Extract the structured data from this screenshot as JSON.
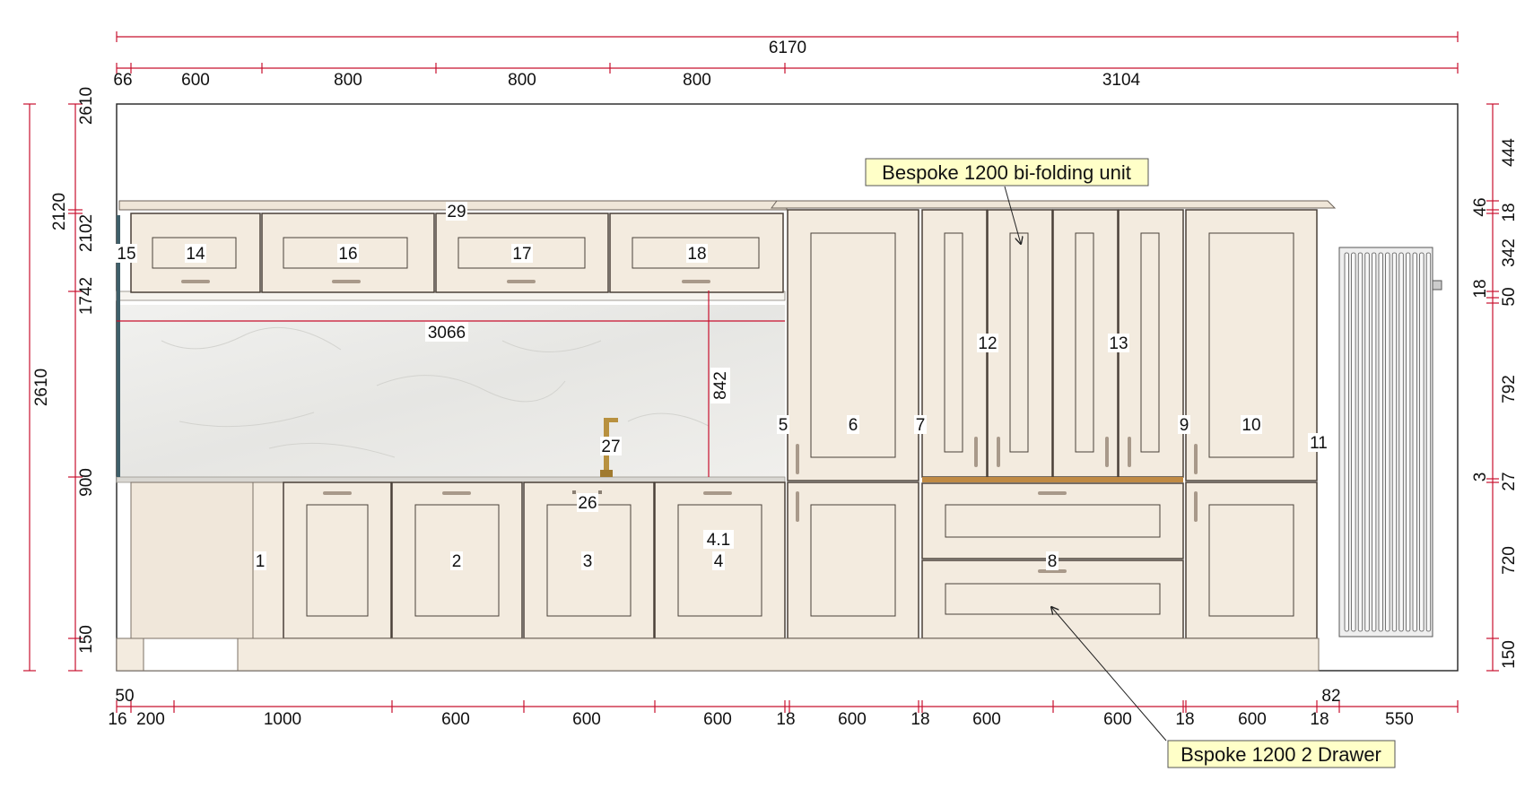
{
  "colors": {
    "dimension_line": "#c8102e",
    "cabinet_fill": "#f3ebdf",
    "cabinet_edge": "#4a4038",
    "splashback": "#ecebe8",
    "callout_fill": "#ffffc8",
    "worktop_wood": "#c08a44",
    "brass": "#b8913f"
  },
  "dimensions": {
    "overall_width": "6170",
    "top_row": [
      "66",
      "600",
      "800",
      "800",
      "800",
      "3104"
    ],
    "bottom_row": [
      "16",
      "200",
      "1000",
      "600",
      "600",
      "600",
      "18",
      "600",
      "18",
      "600",
      "600",
      "18",
      "600",
      "18",
      "550"
    ],
    "bottom_extra": [
      "50",
      "82"
    ],
    "left_outer": "2610",
    "left_inner": [
      "2610",
      "2120",
      "2102",
      "1742",
      "900",
      "150"
    ],
    "right": [
      "444",
      "46",
      "18",
      "342",
      "18",
      "50",
      "792",
      "3",
      "27",
      "720",
      "150"
    ],
    "splash_width": "3066",
    "splash_height": "842"
  },
  "unit_labels": {
    "wall_units": [
      "14",
      "15",
      "16",
      "17",
      "18"
    ],
    "cornice": "29",
    "tall_units": [
      "5",
      "6",
      "7",
      "9",
      "10",
      "11"
    ],
    "bifold": [
      "12",
      "13"
    ],
    "base_units": [
      "1",
      "2",
      "3",
      "4.1",
      "4"
    ],
    "drawer_unit": "8",
    "tap": "27",
    "sink": "26"
  },
  "callouts": {
    "top": "Bespoke 1200 bi-folding unit",
    "bottom": "Bspoke 1200 2 Drawer"
  }
}
